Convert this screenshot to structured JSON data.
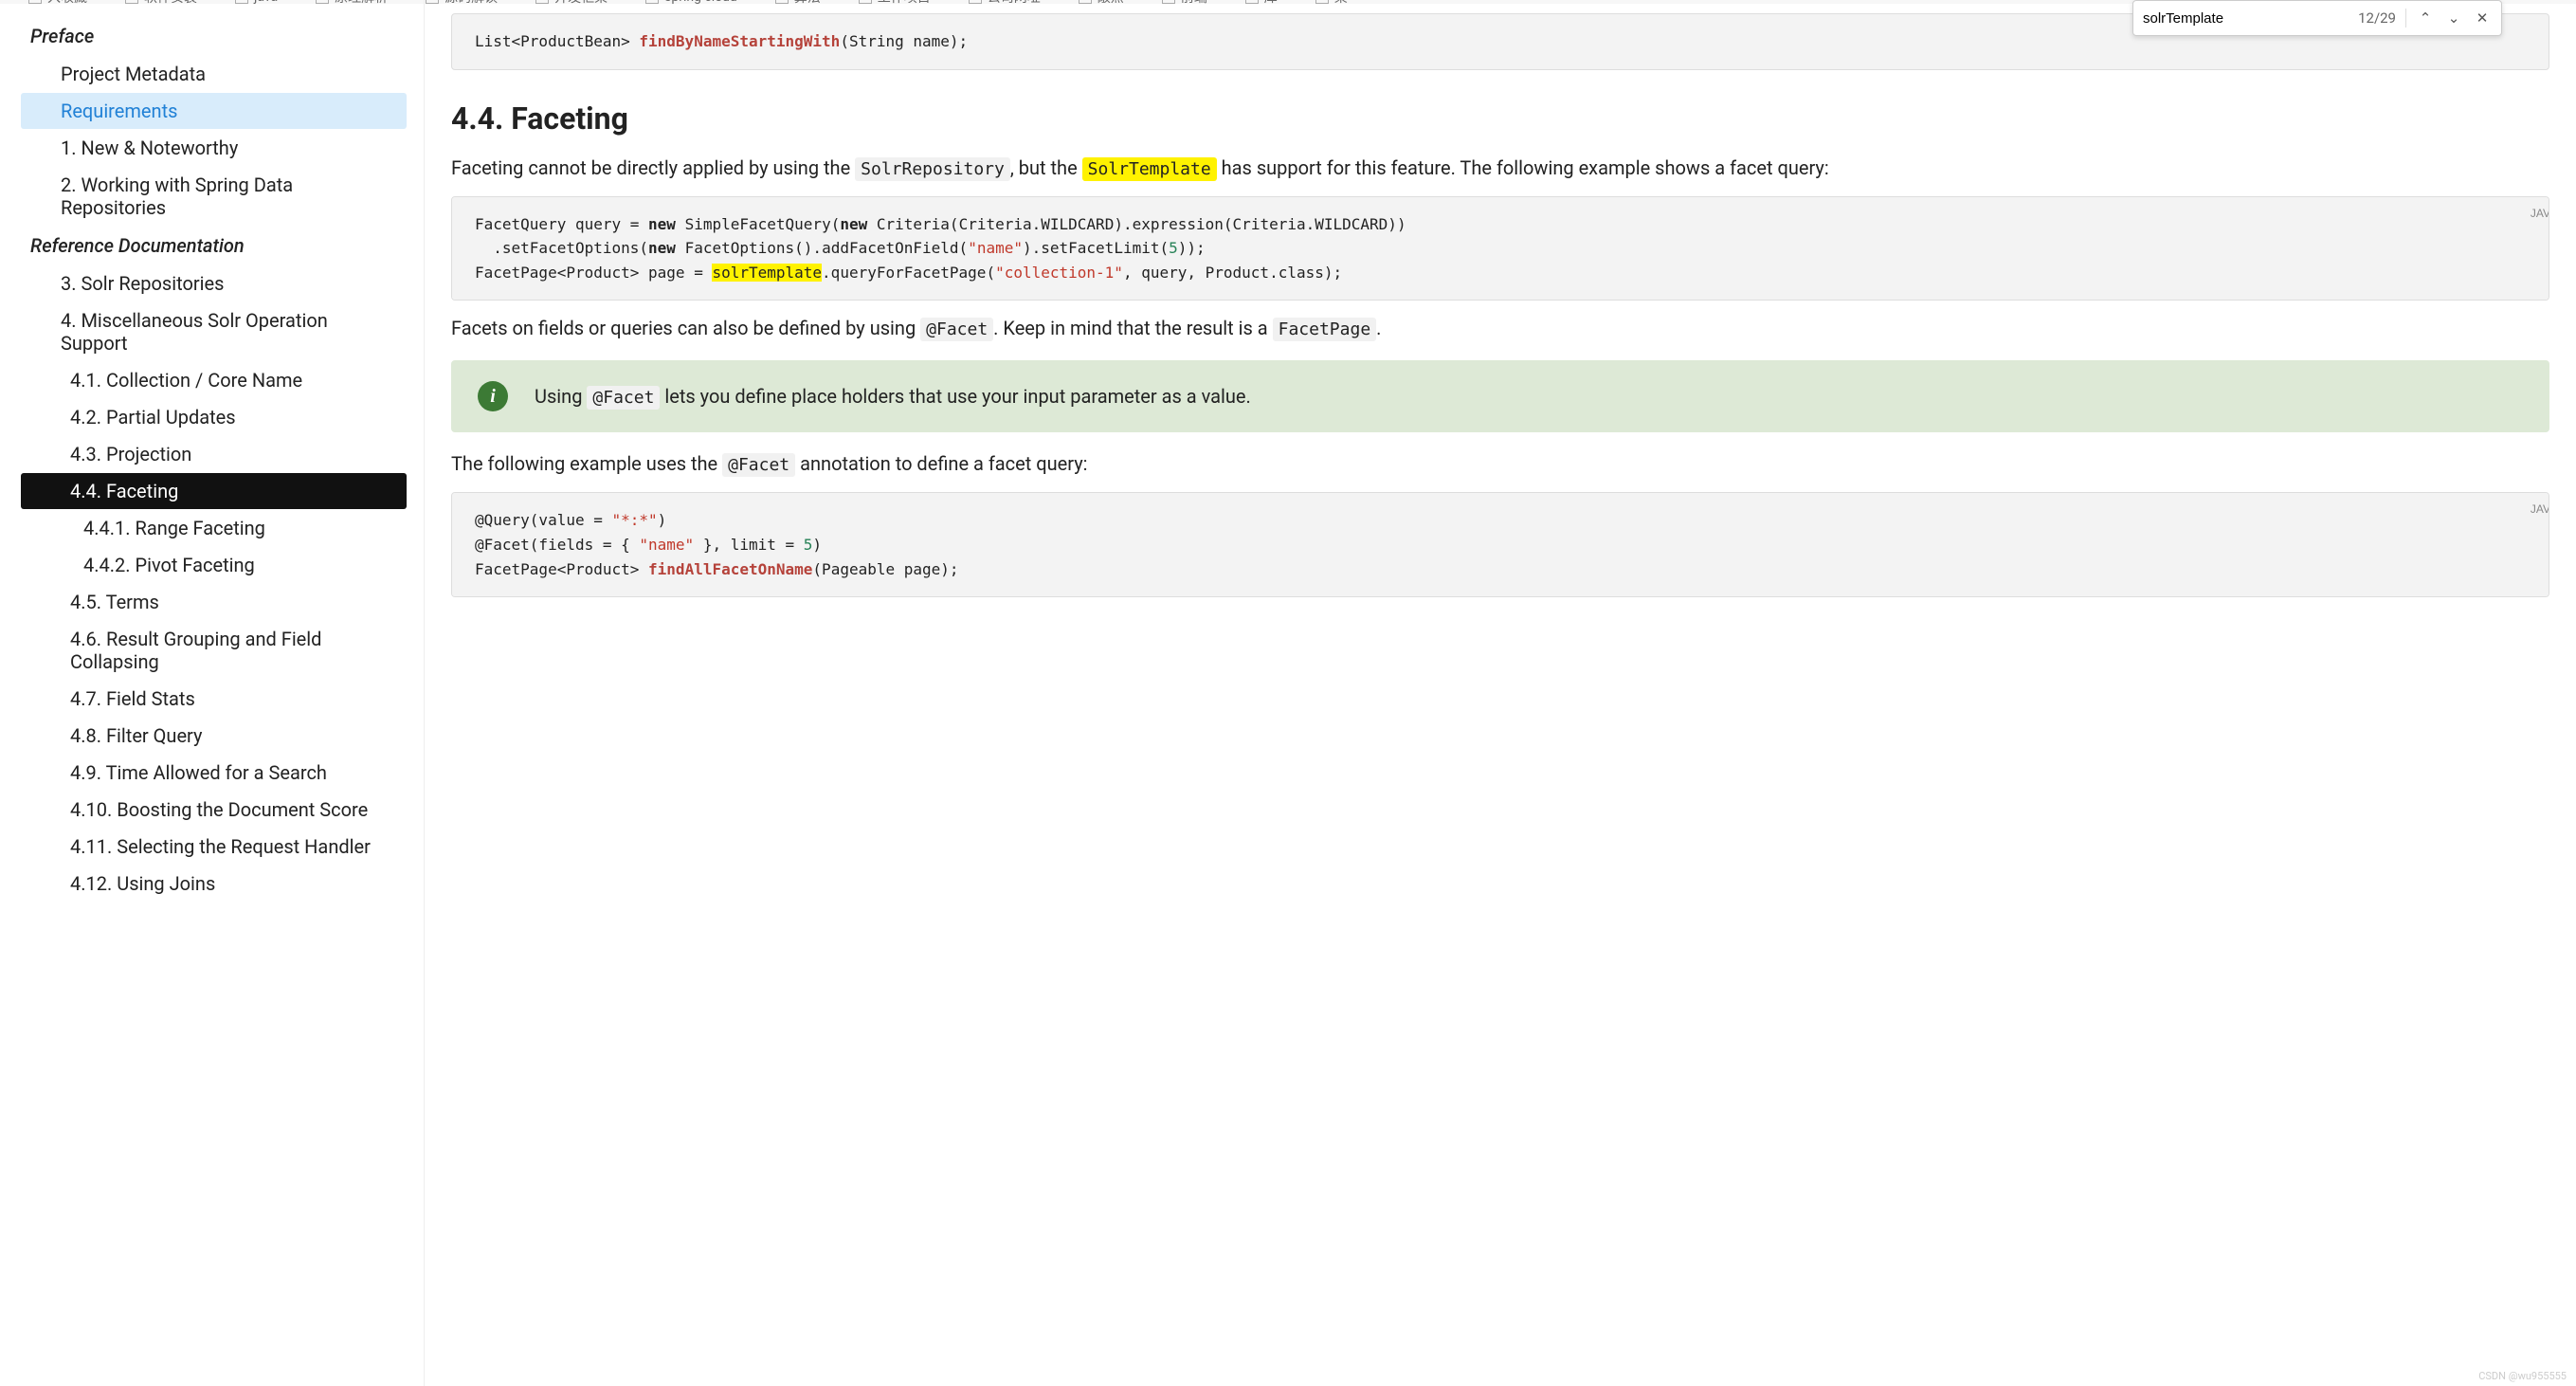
{
  "bookmarks": [
    "入收藏",
    "软件安装",
    "java",
    "原理解析",
    "源码解读",
    "开发框架",
    "spring cloud",
    "算法",
    "工作项目",
    "公司网址",
    "敲点",
    "前端",
    "库",
    "某"
  ],
  "find": {
    "value": "solrTemplate",
    "count": "12/29"
  },
  "nav": {
    "preface": "Preface",
    "refdoc": "Reference Documentation",
    "items": [
      {
        "t": "Project Metadata",
        "lvl": 1
      },
      {
        "t": "Requirements",
        "lvl": 1,
        "sel": "blue"
      },
      {
        "t": "1. New & Noteworthy",
        "lvl": 1
      },
      {
        "t": "2. Working with Spring Data Repositories",
        "lvl": 1
      }
    ],
    "items2": [
      {
        "t": "3. Solr Repositories",
        "lvl": 1
      },
      {
        "t": "4. Miscellaneous Solr Operation Support",
        "lvl": 1
      },
      {
        "t": "4.1. Collection / Core Name",
        "lvl": 2
      },
      {
        "t": "4.2. Partial Updates",
        "lvl": 2
      },
      {
        "t": "4.3. Projection",
        "lvl": 2
      },
      {
        "t": "4.4. Faceting",
        "lvl": 2,
        "sel": "black"
      },
      {
        "t": "4.4.1. Range Faceting",
        "lvl": 3
      },
      {
        "t": "4.4.2. Pivot Faceting",
        "lvl": 3
      },
      {
        "t": "4.5. Terms",
        "lvl": 2
      },
      {
        "t": "4.6. Result Grouping and Field Collapsing",
        "lvl": 2
      },
      {
        "t": "4.7. Field Stats",
        "lvl": 2
      },
      {
        "t": "4.8. Filter Query",
        "lvl": 2
      },
      {
        "t": "4.9. Time Allowed for a Search",
        "lvl": 2
      },
      {
        "t": "4.10. Boosting the Document Score",
        "lvl": 2
      },
      {
        "t": "4.11. Selecting the Request Handler",
        "lvl": 2
      },
      {
        "t": "4.12. Using Joins",
        "lvl": 2
      }
    ]
  },
  "content": {
    "code0_pre": "List<ProductBean> ",
    "code0_fn": "findByNameStartingWith",
    "code0_post": "(String name);",
    "h2": "4.4. Faceting",
    "p1a": "Faceting cannot be directly applied by using the ",
    "p1_code1": "SolrRepository",
    "p1b": ", but the ",
    "p1_code2": "SolrTemplate",
    "p1c": " has support for this feature. The following example shows a facet query:",
    "lang": "JAV",
    "code1": {
      "l1a": "FacetQuery query = ",
      "l1b": "new",
      "l1c": " SimpleFacetQuery(",
      "l1d": "new",
      "l1e": " Criteria(Criteria.WILDCARD).expression(Criteria.WILDCARD))",
      "l2a": "  .setFacetOptions(",
      "l2b": "new",
      "l2c": " FacetOptions().addFacetOnField(",
      "l2d": "\"name\"",
      "l2e": ").setFacetLimit(",
      "l2f": "5",
      "l2g": "));",
      "l3a": "FacetPage<Product> page = ",
      "l3b": "solrTemplate",
      "l3c": ".queryForFacetPage(",
      "l3d": "\"collection-1\"",
      "l3e": ", query, Product.class);"
    },
    "p2a": "Facets on fields or queries can also be defined by using ",
    "p2_code": "@Facet",
    "p2b": ". Keep in mind that the result is a ",
    "p2_code2": "FacetPage",
    "p2c": ".",
    "note_a": "Using ",
    "note_code": "@Facet",
    "note_b": " lets you define place holders that use your input parameter as a value.",
    "p3a": "The following example uses the ",
    "p3_code": "@Facet",
    "p3b": " annotation to define a facet query:",
    "code2": {
      "l1a": "@Query(value = ",
      "l1b": "\"*:*\"",
      "l1c": ")",
      "l2a": "@Facet(fields = { ",
      "l2b": "\"name\"",
      "l2c": " }, limit = ",
      "l2d": "5",
      "l2e": ")",
      "l3a": "FacetPage<Product> ",
      "l3b": "findAllFacetOnName",
      "l3c": "(Pageable page);"
    }
  },
  "watermark": "CSDN @wu955555"
}
